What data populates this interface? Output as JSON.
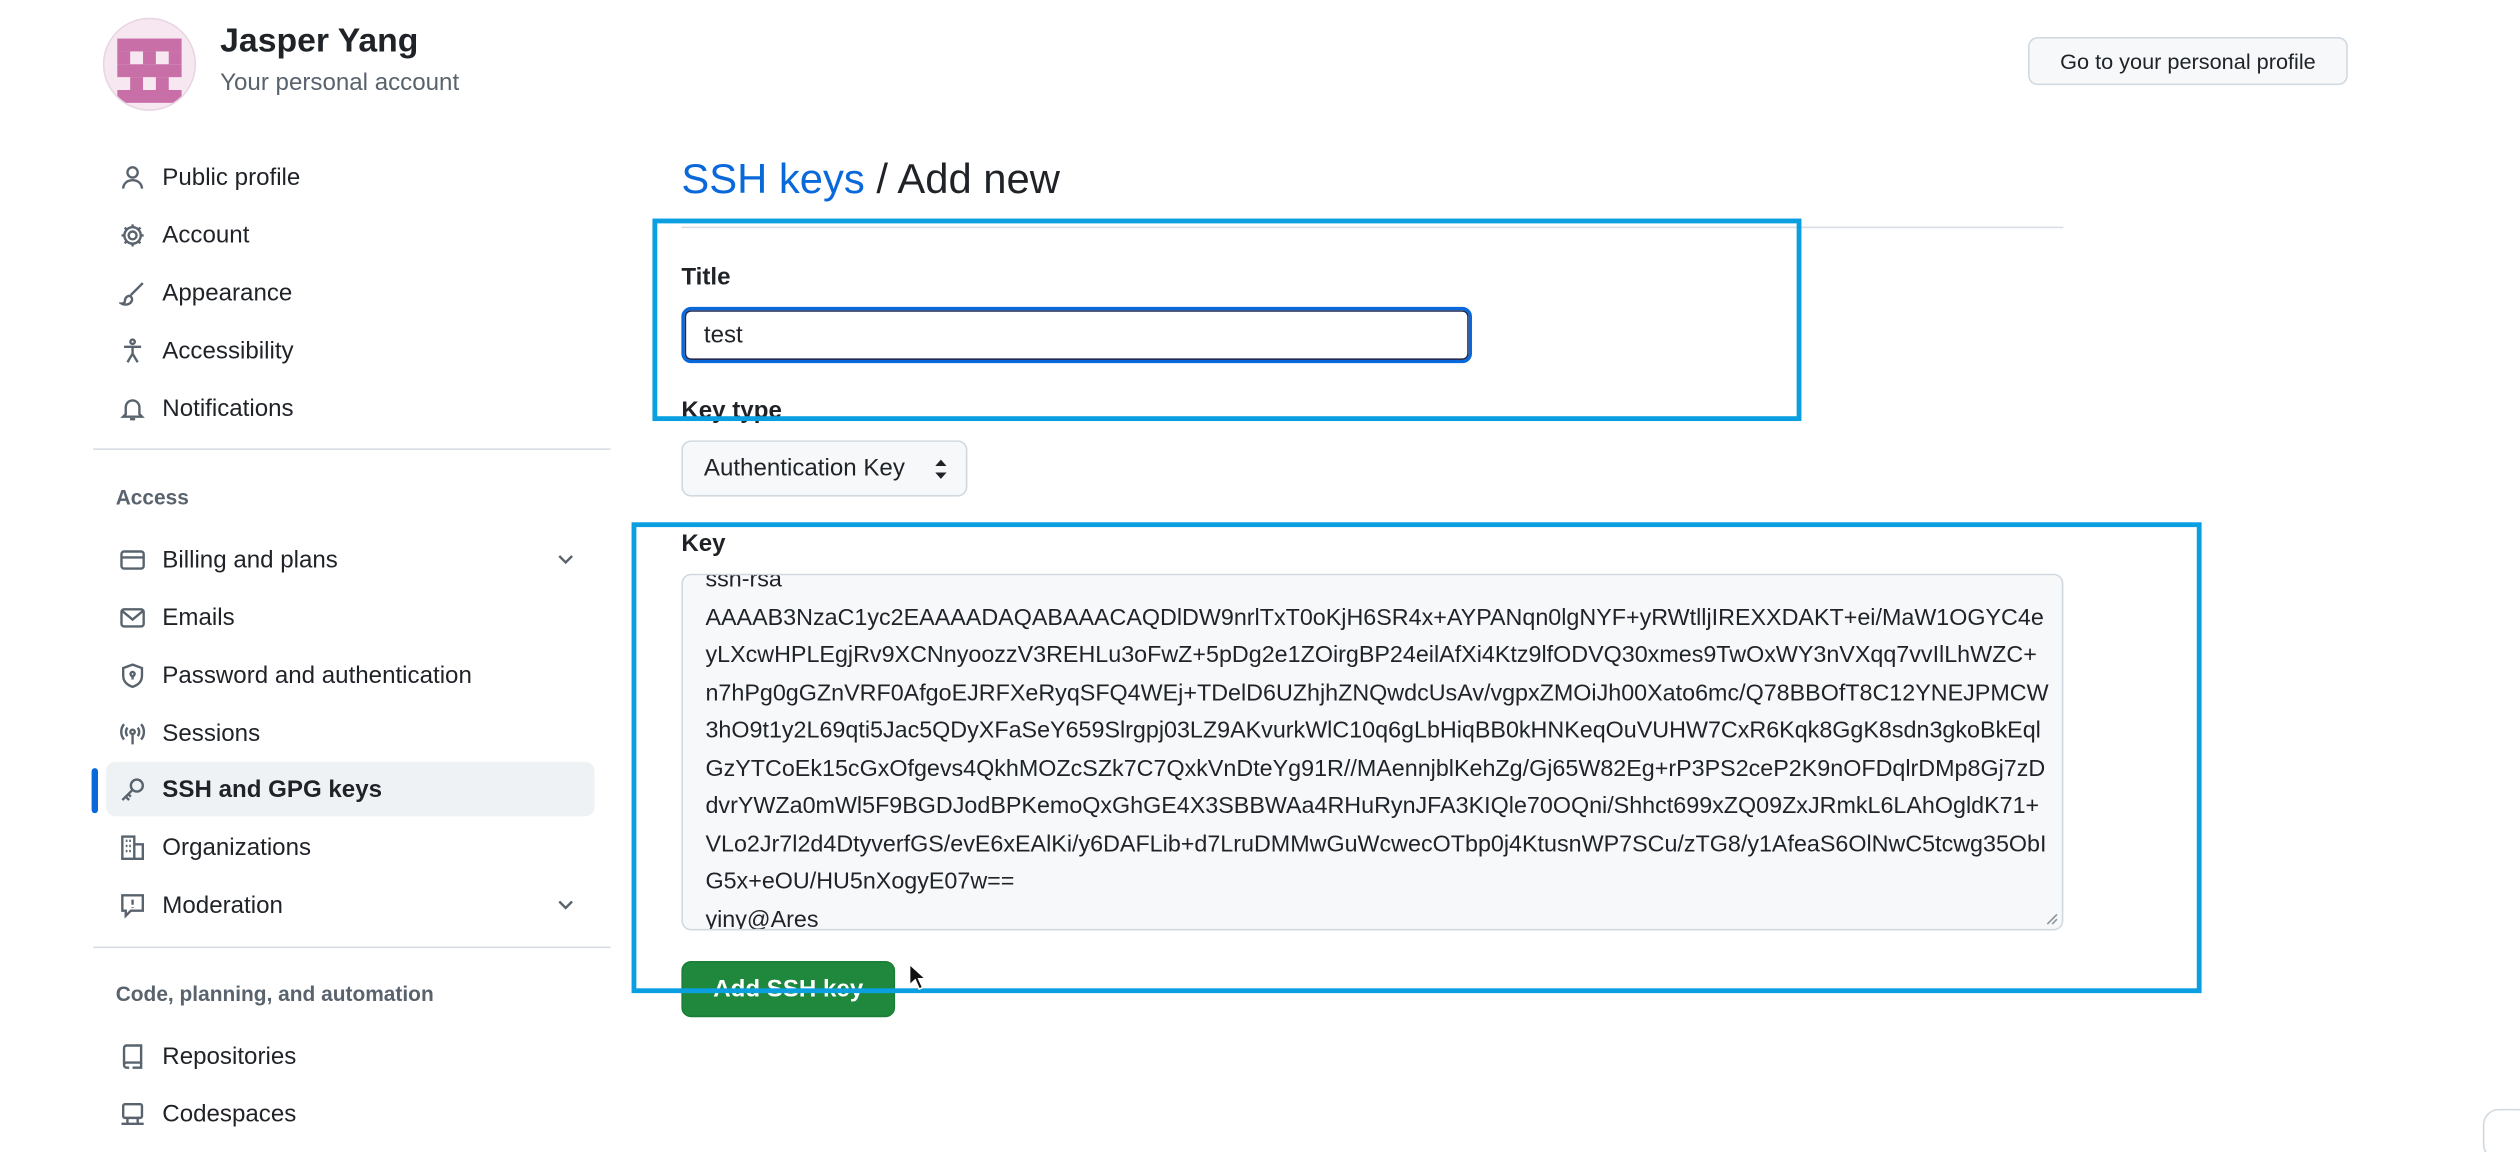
{
  "header": {
    "user_name": "Jasper Yang",
    "account_label": "Your personal account",
    "profile_button": "Go to your personal profile"
  },
  "sidebar": {
    "top_items": [
      {
        "label": "Public profile",
        "icon": "person-icon"
      },
      {
        "label": "Account",
        "icon": "gear-icon"
      },
      {
        "label": "Appearance",
        "icon": "paintbrush-icon"
      },
      {
        "label": "Accessibility",
        "icon": "accessibility-icon"
      },
      {
        "label": "Notifications",
        "icon": "bell-icon"
      }
    ],
    "access_heading": "Access",
    "access_items": [
      {
        "label": "Billing and plans",
        "icon": "credit-card-icon",
        "expandable": true
      },
      {
        "label": "Emails",
        "icon": "mail-icon"
      },
      {
        "label": "Password and authentication",
        "icon": "shield-lock-icon"
      },
      {
        "label": "Sessions",
        "icon": "broadcast-icon"
      },
      {
        "label": "SSH and GPG keys",
        "icon": "key-icon",
        "selected": true
      },
      {
        "label": "Organizations",
        "icon": "organization-icon"
      },
      {
        "label": "Moderation",
        "icon": "report-icon",
        "expandable": true
      }
    ],
    "code_heading": "Code, planning, and automation",
    "code_items": [
      {
        "label": "Repositories",
        "icon": "repo-icon"
      },
      {
        "label": "Codespaces",
        "icon": "codespaces-icon"
      }
    ]
  },
  "main": {
    "breadcrumb_link": "SSH keys",
    "breadcrumb_separator": " / ",
    "page_title": "Add new",
    "title_label": "Title",
    "title_value": "test",
    "key_type_label": "Key type",
    "key_type_value": "Authentication Key",
    "key_label": "Key",
    "key_value": "ssh-rsa\nAAAAB3NzaC1yc2EAAAADAQABAAACAQDlDW9nrlTxT0oKjH6SR4x+AYPANqn0lgNYF+yRWtlljIREXXDAKT+ei/MaW1OGYC4eyLXcwHPLEgjRv9XCNnyoozzV3REHLu3oFwZ+5pDg2e1ZOirgBP24eilAfXi4Ktz9lfODVQ30xmes9TwOxWY3nVXqq7vvIlLhWZC+n7hPg0gGZnVRF0AfgoEJRFXeRyqSFQ4WEj+TDelD6UZhjhZNQwdcUsAv/vgpxZMOiJh00Xato6mc/Q78BBOfT8C12YNEJPMCW3hO9t1y2L69qti5Jac5QDyXFaSeY659Slrgpj03LZ9AKvurkWlC10q6gLbHiqBB0kHNKeqOuVUHW7CxR6Kqk8GgK8sdn3gkoBkEqlGzYTCoEk15cGxOfgevs4QkhMOZcSZk7C7QxkVnDteYg91R//MAennjblKehZg/Gj65W82Eg+rP3PS2ceP2K9nOFDqlrDMp8Gj7zDdvrYWZa0mWl5F9BGDJodBPKemoQxGhGE4X3SBBWAa4RHuRynJFA3KIQle70OQni/Shhct699xZQ09ZxJRmkL6LAhOgldK71+VLo2Jr7l2d4DtyverfGS/evE6xEAlKi/y6DAFLib+d7LruDMMwGuWcwecOTbp0j4KtusnWP7SCu/zTG8/y1AfeaS6OlNwC5tcwg35ObIG5x+eOU/HU5nXogyE07w==\nyiny@Ares",
    "submit_button": "Add SSH key"
  },
  "colors": {
    "accent": "#0969da",
    "highlight": "#0a9fe0",
    "primary_button": "#1f883d"
  }
}
